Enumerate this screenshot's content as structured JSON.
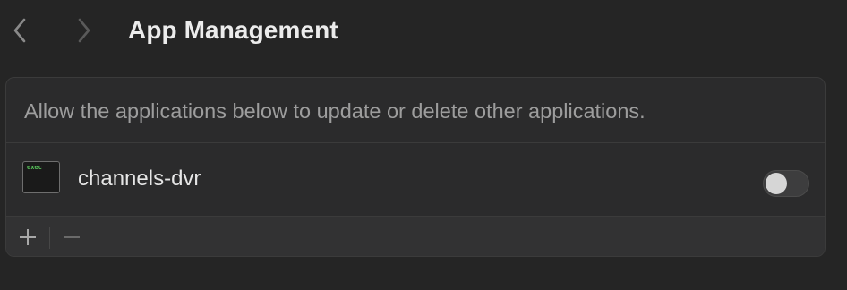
{
  "header": {
    "title": "App Management",
    "back_icon": "chevron-left-icon",
    "forward_icon": "chevron-right-icon"
  },
  "panel": {
    "description": "Allow the applications below to update or delete other applications.",
    "apps": [
      {
        "name": "channels-dvr",
        "icon": "terminal-exec-icon",
        "icon_text": "exec",
        "enabled": false
      }
    ],
    "footer": {
      "add_icon": "plus-icon",
      "remove_icon": "minus-icon"
    }
  },
  "colors": {
    "background": "#252525",
    "panel": "#2b2b2c",
    "footer": "#323233",
    "exec_text": "#57c15a"
  }
}
